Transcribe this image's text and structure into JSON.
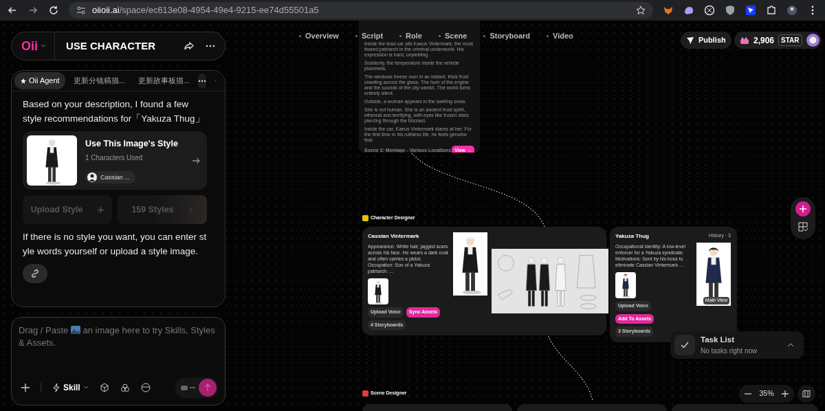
{
  "browser": {
    "host": "oiioii.ai",
    "path": "/space/ec613e08-4954-49e4-9215-ee74d55501a5"
  },
  "header": {
    "logo": "Oii",
    "title": "USE CHARACTER"
  },
  "agent": {
    "tabs": [
      {
        "label": "Oii Agent",
        "selected": true
      },
      {
        "label": "更新分镜稿描...",
        "selected": false
      },
      {
        "label": "更新故事板描...",
        "selected": false
      }
    ],
    "message": "Based on your description, I found a few style recommendations for「Yakuza Thug」",
    "style_card": {
      "title": "Use This Image's Style",
      "subtitle": "1 Characters Used",
      "chip": "Cassian ..."
    },
    "upload_style": "Upload Style",
    "styles": "159 Styles",
    "hint": "If there is no style you want, you can enter style words yourself or upload a style image."
  },
  "composer": {
    "placeholder_start": "Drag / Paste",
    "placeholder_end": "an image here to try Skills, Styles & Assets.",
    "skill": "Skill"
  },
  "canvas": {
    "nav": [
      "Overview",
      "Script",
      "Role",
      "Scene",
      "Storyboard",
      "Video"
    ],
    "publish": "Publish",
    "credits": "2,906",
    "credit_unit": "STAR",
    "script_card": {
      "lines": [
        "Inside the lead car sits Kaeus Vintermark, the most feared patriarch in the criminal underworld. His expression is hard, unyielding.",
        "Suddenly, the temperature inside the vehicle plummets.",
        "The windows freeze over in an instant, thick frost crawling across the glass. The hum of the engine and the sounds of the city vanish. The world turns entirely silent.",
        "Outside, a woman appears in the swirling snow.",
        "She is not human. She is an ancient frost spirit, ethereal and terrifying, with eyes like frozen stars piercing through the blizzard.",
        "Inside the car, Kaeus Vintermark stares at her. For the first time in his ruthless life, he feels genuine fear."
      ],
      "heading": "Scene 3: Montage - Various Locations",
      "view": "View →"
    },
    "character_label": "Character Designer",
    "cards": [
      {
        "name": "Cassian Vintermark",
        "lines": [
          "Appearance: White hair, jagged scars across his face. He wears a dark coat and often carries a pistol.",
          "Occupation: Son of a Yakuza patriarch. ..."
        ],
        "buttons": [
          {
            "label": "Upload Voice",
            "kind": "plain"
          },
          {
            "label": "Sync Assets",
            "kind": "accent"
          },
          {
            "label": "4 Storyboards",
            "kind": "plain"
          }
        ]
      },
      {
        "name": "Yakuza Thug",
        "history": "History · 3",
        "lines": [
          "Occupational identity: A low-level enforcer for a Yakuza syndicate.",
          "Motivations: Sent by his boss to eliminate Cassian Vintermark. ..."
        ],
        "buttons": [
          {
            "label": "Upload Voice",
            "kind": "plain"
          },
          {
            "label": "Add To Assets",
            "kind": "accent"
          },
          {
            "label": "3 Storyboards",
            "kind": "plain"
          }
        ],
        "badge": "Main View"
      }
    ],
    "scene_label": "Scene Designer",
    "task_list": {
      "title": "Task List",
      "subtitle": "No tasks right now"
    },
    "zoom": "35%"
  }
}
